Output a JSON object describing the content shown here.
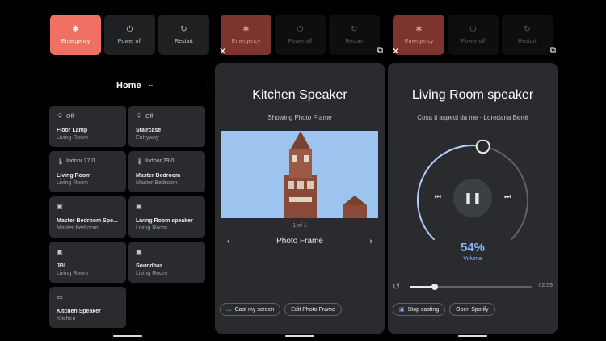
{
  "power": {
    "emergency": {
      "label": "Emergency",
      "icon": "asterisk-icon"
    },
    "power_off": {
      "label": "Power off",
      "icon": "power-icon"
    },
    "restart": {
      "label": "Restart",
      "icon": "restart-icon"
    }
  },
  "home": {
    "title": "Home",
    "tiles": [
      {
        "top": "Off",
        "icon": "bulb-icon",
        "name": "Floor Lamp",
        "room": "Living Room"
      },
      {
        "top": "Off",
        "icon": "bulb-icon",
        "name": "Staircase",
        "room": "Entryway"
      },
      {
        "top": "Indoor 27.0",
        "icon": "thermometer-icon",
        "name": "Living Room",
        "room": "Living Room"
      },
      {
        "top": "Indoor 29.0",
        "icon": "thermometer-icon",
        "name": "Master Bedroom",
        "room": "Master Bedroom"
      },
      {
        "top": "",
        "icon": "speaker-icon",
        "name": "Master Bedroom Spe...",
        "room": "Master Bedroom"
      },
      {
        "top": "",
        "icon": "speaker-icon",
        "name": "Living Room speaker",
        "room": "Living Room"
      },
      {
        "top": "",
        "icon": "speaker-icon",
        "name": "JBL",
        "room": "Living Room"
      },
      {
        "top": "",
        "icon": "speaker-icon",
        "name": "Soundbar",
        "room": "Living Room"
      },
      {
        "top": "",
        "icon": "tv-icon",
        "name": "Kitchen Speaker",
        "room": "Kitchen"
      }
    ]
  },
  "kitchen": {
    "title": "Kitchen Speaker",
    "subtitle": "Showing Photo Frame",
    "page_indicator": "1 of 1",
    "photo_label": "Photo Frame",
    "cast_label": "Cast my screen",
    "edit_label": "Edit Photo Frame"
  },
  "living": {
    "title": "Living Room speaker",
    "subtitle": "Cosa ti aspetti da me · Loredana Bertè",
    "volume_pct": "54%",
    "volume_label": "Volume",
    "volume_fraction": 0.54,
    "elapsed_time": "02:59",
    "progress_fraction": 0.2,
    "stop_label": "Stop casting",
    "spotify_label": "Open Spotify"
  },
  "colors": {
    "emergency": "#f07163",
    "accent": "#8ab4f8",
    "card": "#2a2b2e"
  }
}
